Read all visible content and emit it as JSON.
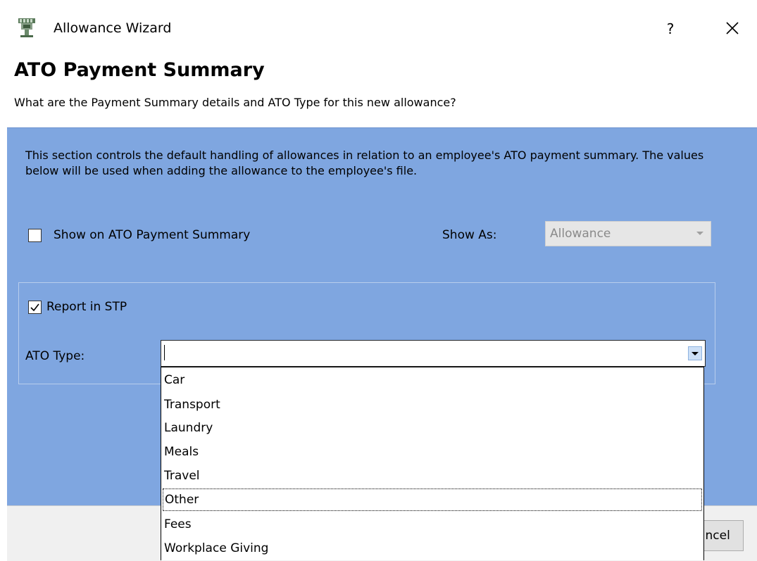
{
  "window": {
    "title": "Allowance Wizard",
    "help_label": "?",
    "close_label": "×"
  },
  "header": {
    "title": "ATO Payment Summary",
    "subtitle": "What are the Payment Summary details and ATO Type for this new allowance?"
  },
  "content": {
    "description": "This section controls the default handling of allowances in relation to an employee's ATO payment summary. The values below will be used when adding the allowance to the employee's file.",
    "show_on_summary": {
      "label": "Show on ATO Payment Summary",
      "checked": false
    },
    "show_as": {
      "label": "Show As:",
      "value": "Allowance",
      "enabled": false
    },
    "report_in_stp": {
      "label": "Report in STP",
      "checked": true
    },
    "ato_type": {
      "label": "ATO Type:",
      "value": "",
      "options": [
        "Car",
        "Transport",
        "Laundry",
        "Meals",
        "Travel",
        "Other",
        "Fees",
        "Workplace Giving"
      ],
      "focused_option": "Other"
    }
  },
  "footer": {
    "cancel_label": "Cancel"
  },
  "colors": {
    "panel": "#7fa6e0",
    "footer": "#f0f0f0",
    "disabled_text": "#8a8a8a"
  },
  "icons": {
    "app": "allowance-wizard-icon",
    "close": "close-icon",
    "dropdown": "chevron-down-icon",
    "checkmark": "checkmark-icon"
  }
}
